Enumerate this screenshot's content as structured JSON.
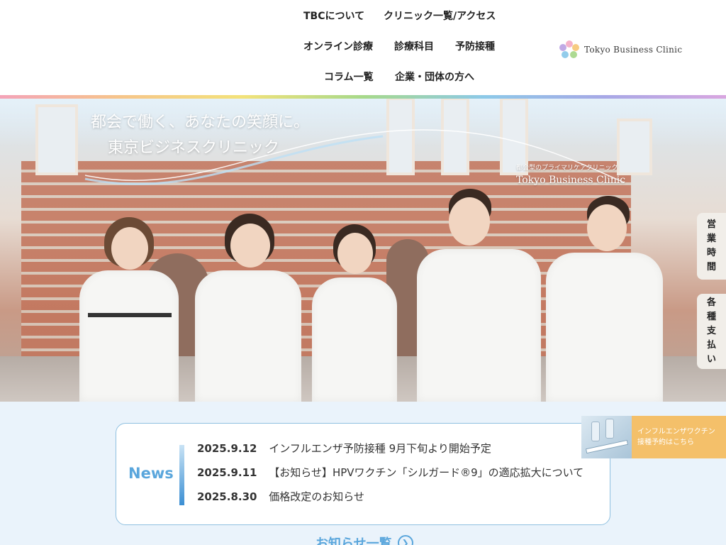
{
  "nav": {
    "row1": [
      "TBCについて",
      "クリニック一覧/アクセス"
    ],
    "row2": [
      "オンライン診療",
      "診療科目",
      "予防接種"
    ],
    "row3": [
      "コラム一覧",
      "企業・団体の方へ"
    ]
  },
  "logo": {
    "text": "Tokyo Business Clinic"
  },
  "hero": {
    "tagline_line1": "都会で働く、あなたの笑顔に。",
    "tagline_line2": "東京ビジネスクリニック",
    "sub_small": "都会型のプライマリケアクリニック",
    "sub_en": "Tokyo Business Clinic"
  },
  "side_tabs": {
    "hours": [
      "営",
      "業",
      "時",
      "間"
    ],
    "payment": [
      "各",
      "種",
      "支",
      "払",
      "い"
    ]
  },
  "banner": {
    "line1": "インフルエンザワクチン",
    "line2": "接種予約はこちら"
  },
  "news": {
    "label": "News",
    "items": [
      {
        "date": "2025.9.12",
        "title": "インフルエンザ予防接種 9月下旬より開始予定"
      },
      {
        "date": "2025.9.11",
        "title": "【お知らせ】HPVワクチン「シルガード®9」の適応拡大について"
      },
      {
        "date": "2025.8.30",
        "title": "価格改定のお知らせ"
      }
    ],
    "more_label": "お知らせ一覧"
  },
  "colors": {
    "accent": "#5aa6dc",
    "banner": "#f4c06a",
    "border": "#8fc0e0"
  }
}
